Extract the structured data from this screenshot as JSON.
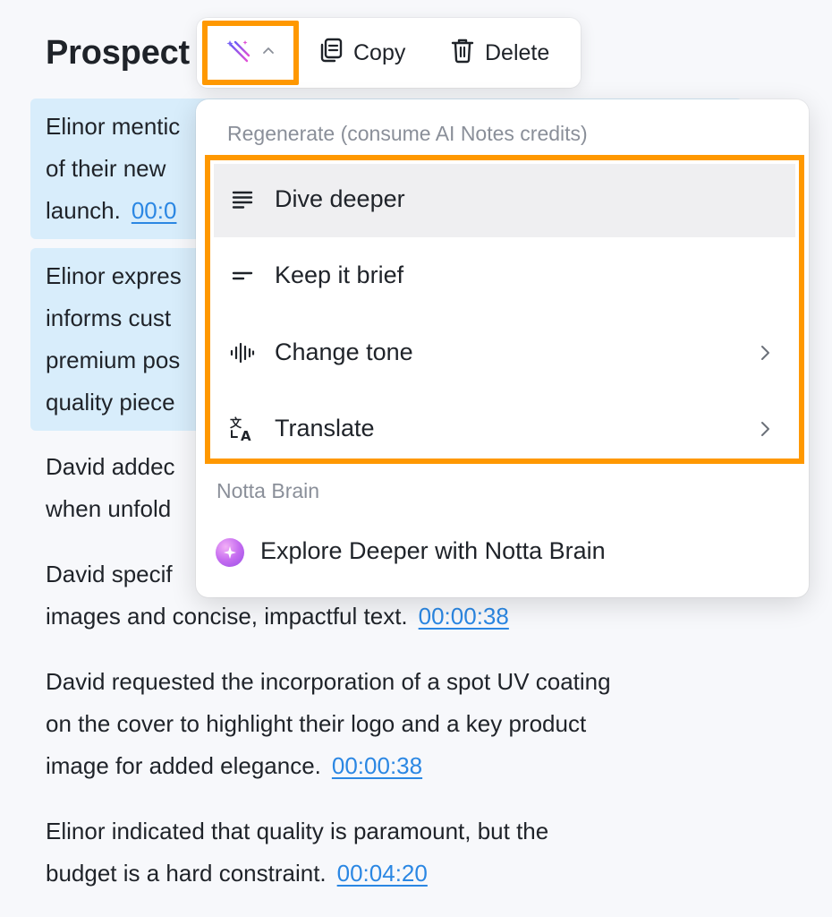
{
  "page": {
    "title": "Prospect"
  },
  "notes": [
    {
      "text": "Elinor mentic",
      "line2": "of their new",
      "line3": "launch.",
      "timestamp": "00:0"
    },
    {
      "text": "Elinor expres",
      "line2": "informs cust",
      "line3": "premium pos",
      "line4": "quality piece"
    },
    {
      "text": "David addec",
      "line2": "when unfold"
    },
    {
      "text": "David specif",
      "line2": "images and concise, impactful text.",
      "timestamp": "00:00:38"
    },
    {
      "line1": "David requested the incorporation of a spot UV coating",
      "line2": "on the cover to highlight their logo and a key product",
      "line3": "image for added elegance.",
      "timestamp": "00:00:38"
    },
    {
      "line1": "Elinor indicated that quality is paramount, but the",
      "line2": "budget is a hard constraint.",
      "timestamp": "00:04:20"
    }
  ],
  "toolbar": {
    "ai_icon": "magic-wand-icon",
    "copy_label": "Copy",
    "delete_label": "Delete"
  },
  "menu": {
    "regenerate_label": "Regenerate (consume AI Notes credits)",
    "items": [
      {
        "label": "Dive deeper",
        "icon": "lines-icon",
        "has_submenu": false,
        "active": true
      },
      {
        "label": "Keep it brief",
        "icon": "short-lines-icon",
        "has_submenu": false,
        "active": false
      },
      {
        "label": "Change tone",
        "icon": "soundwave-icon",
        "has_submenu": true,
        "active": false
      },
      {
        "label": "Translate",
        "icon": "translate-icon",
        "has_submenu": true,
        "active": false
      }
    ],
    "brain_section_label": "Notta Brain",
    "brain_item_label": "Explore Deeper with Notta Brain"
  },
  "colors": {
    "highlight_orange": "#ff9800",
    "note_highlight": "#d8edfb",
    "link_blue": "#2b87e3"
  }
}
